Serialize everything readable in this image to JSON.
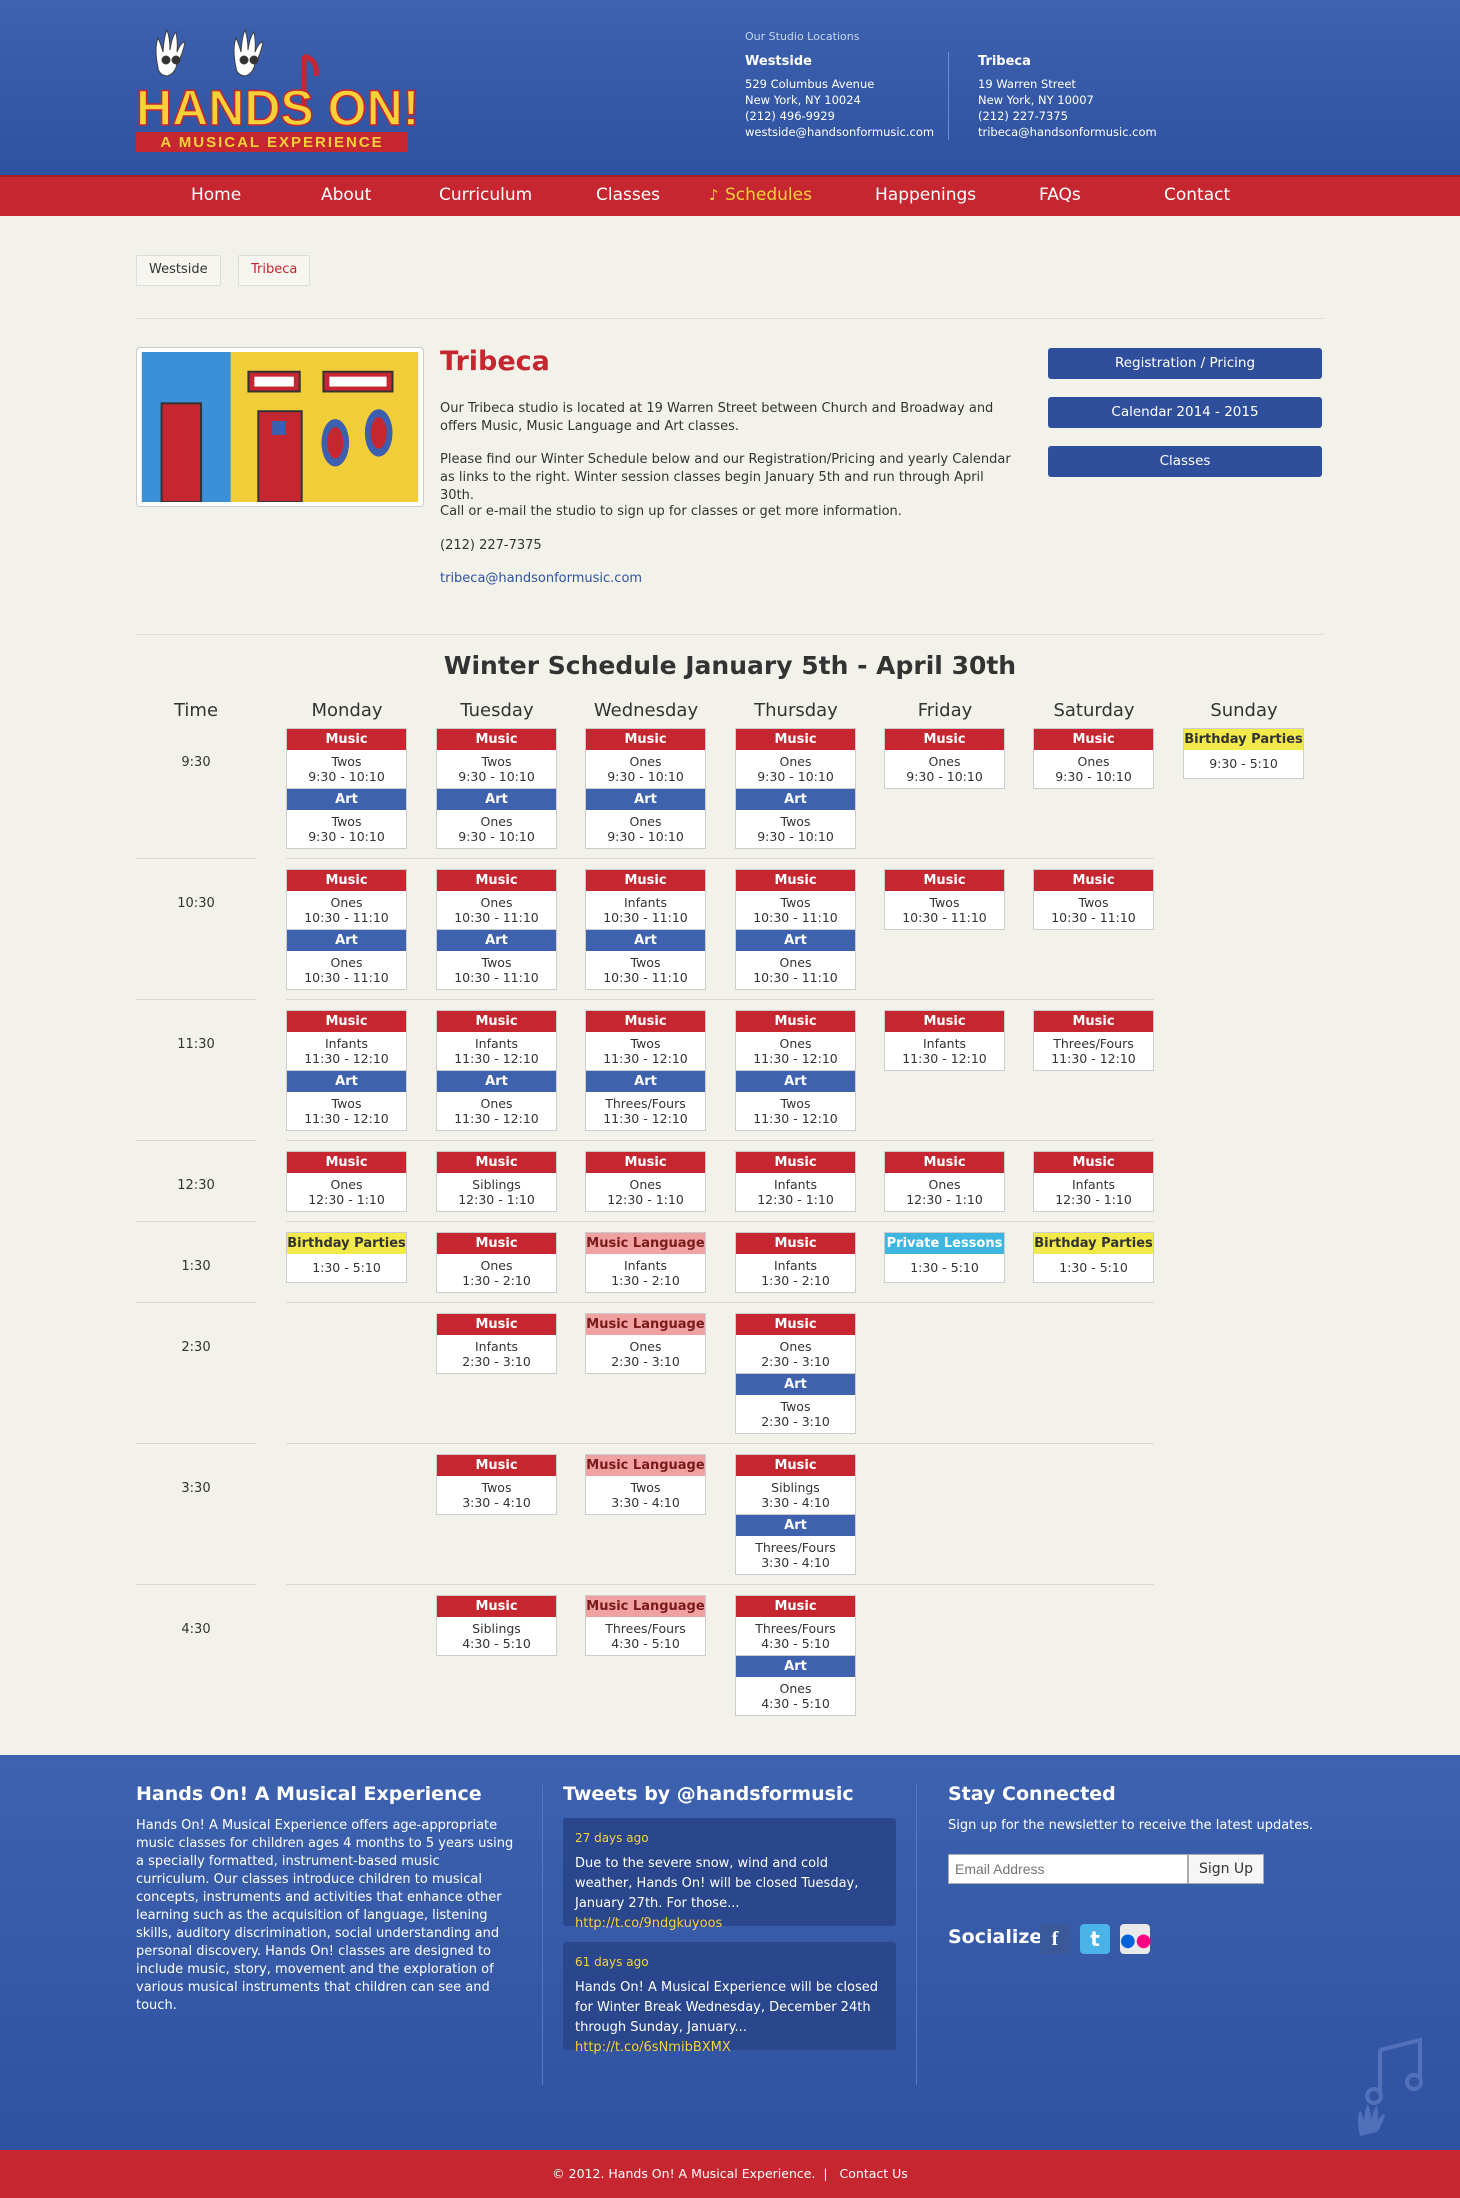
{
  "header": {
    "logo_text": "HANDS ON!",
    "logo_sub": "A MUSICAL EXPERIENCE",
    "locations_title": "Our Studio Locations",
    "locations": [
      {
        "name": "Westside",
        "address1": "529 Columbus Avenue",
        "address2": "New York, NY 10024",
        "phone": "(212) 496-9929",
        "email": "westside@handsonformusic.com"
      },
      {
        "name": "Tribeca",
        "address1": "19 Warren Street",
        "address2": "New York, NY 10007",
        "phone": "(212) 227-7375",
        "email": "tribeca@handsonformusic.com"
      }
    ]
  },
  "nav": {
    "items": [
      "Home",
      "About",
      "Curriculum",
      "Classes",
      "Schedules",
      "Happenings",
      "FAQs",
      "Contact"
    ],
    "active": "Schedules"
  },
  "tabs": [
    "Westside",
    "Tribeca"
  ],
  "intro": {
    "title": "Tribeca",
    "p1": "Our Tribeca studio is located at 19 Warren Street between Church and Broadway and offers Music, Music Language and Art classes.",
    "p2": "Please find our Winter Schedule below and our Registration/Pricing and yearly Calendar as links to the right. Winter session classes begin January 5th and run through April 30th.",
    "p3": "Call or e-mail the studio to sign up for classes or get more information.",
    "phone": "(212) 227-7375",
    "email": "tribeca@handsonformusic.com"
  },
  "side_buttons": [
    "Registration / Pricing",
    "Calendar 2014 - 2015",
    "Classes"
  ],
  "schedule": {
    "title": "Winter Schedule January 5th - April 30th",
    "time_header": "Time",
    "days": [
      "Monday",
      "Tuesday",
      "Wednesday",
      "Thursday",
      "Friday",
      "Saturday",
      "Sunday"
    ],
    "rows": [
      {
        "time": "9:30",
        "cells": [
          [
            {
              "type": "Music",
              "age": "Twos",
              "t": "9:30 - 10:10"
            },
            {
              "type": "Art",
              "age": "Twos",
              "t": "9:30 - 10:10"
            }
          ],
          [
            {
              "type": "Music",
              "age": "Twos",
              "t": "9:30 - 10:10"
            },
            {
              "type": "Art",
              "age": "Ones",
              "t": "9:30 - 10:10"
            }
          ],
          [
            {
              "type": "Music",
              "age": "Ones",
              "t": "9:30 - 10:10"
            },
            {
              "type": "Art",
              "age": "Ones",
              "t": "9:30 - 10:10"
            }
          ],
          [
            {
              "type": "Music",
              "age": "Ones",
              "t": "9:30 - 10:10"
            },
            {
              "type": "Art",
              "age": "Twos",
              "t": "9:30 - 10:10"
            }
          ],
          [
            {
              "type": "Music",
              "age": "Ones",
              "t": "9:30 - 10:10"
            }
          ],
          [
            {
              "type": "Music",
              "age": "Ones",
              "t": "9:30 - 10:10"
            }
          ],
          [
            {
              "type": "Birthday Parties",
              "age": "",
              "t": "9:30 - 5:10"
            }
          ]
        ]
      },
      {
        "time": "10:30",
        "cells": [
          [
            {
              "type": "Music",
              "age": "Ones",
              "t": "10:30 - 11:10"
            },
            {
              "type": "Art",
              "age": "Ones",
              "t": "10:30 - 11:10"
            }
          ],
          [
            {
              "type": "Music",
              "age": "Ones",
              "t": "10:30 - 11:10"
            },
            {
              "type": "Art",
              "age": "Twos",
              "t": "10:30 - 11:10"
            }
          ],
          [
            {
              "type": "Music",
              "age": "Infants",
              "t": "10:30 - 11:10"
            },
            {
              "type": "Art",
              "age": "Twos",
              "t": "10:30 - 11:10"
            }
          ],
          [
            {
              "type": "Music",
              "age": "Twos",
              "t": "10:30 - 11:10"
            },
            {
              "type": "Art",
              "age": "Ones",
              "t": "10:30 - 11:10"
            }
          ],
          [
            {
              "type": "Music",
              "age": "Twos",
              "t": "10:30 - 11:10"
            }
          ],
          [
            {
              "type": "Music",
              "age": "Twos",
              "t": "10:30 - 11:10"
            }
          ],
          []
        ]
      },
      {
        "time": "11:30",
        "cells": [
          [
            {
              "type": "Music",
              "age": "Infants",
              "t": "11:30 - 12:10"
            },
            {
              "type": "Art",
              "age": "Twos",
              "t": "11:30 - 12:10"
            }
          ],
          [
            {
              "type": "Music",
              "age": "Infants",
              "t": "11:30 - 12:10"
            },
            {
              "type": "Art",
              "age": "Ones",
              "t": "11:30 - 12:10"
            }
          ],
          [
            {
              "type": "Music",
              "age": "Twos",
              "t": "11:30 - 12:10"
            },
            {
              "type": "Art",
              "age": "Threes/Fours",
              "t": "11:30 - 12:10"
            }
          ],
          [
            {
              "type": "Music",
              "age": "Ones",
              "t": "11:30 - 12:10"
            },
            {
              "type": "Art",
              "age": "Twos",
              "t": "11:30 - 12:10"
            }
          ],
          [
            {
              "type": "Music",
              "age": "Infants",
              "t": "11:30 - 12:10"
            }
          ],
          [
            {
              "type": "Music",
              "age": "Threes/Fours",
              "t": "11:30 - 12:10"
            }
          ],
          []
        ]
      },
      {
        "time": "12:30",
        "cells": [
          [
            {
              "type": "Music",
              "age": "Ones",
              "t": "12:30 - 1:10"
            }
          ],
          [
            {
              "type": "Music",
              "age": "Siblings",
              "t": "12:30 - 1:10"
            }
          ],
          [
            {
              "type": "Music",
              "age": "Ones",
              "t": "12:30 - 1:10"
            }
          ],
          [
            {
              "type": "Music",
              "age": "Infants",
              "t": "12:30 - 1:10"
            }
          ],
          [
            {
              "type": "Music",
              "age": "Ones",
              "t": "12:30 - 1:10"
            }
          ],
          [
            {
              "type": "Music",
              "age": "Infants",
              "t": "12:30 - 1:10"
            }
          ],
          []
        ]
      },
      {
        "time": "1:30",
        "cells": [
          [
            {
              "type": "Birthday Parties",
              "age": "",
              "t": "1:30 - 5:10"
            }
          ],
          [
            {
              "type": "Music",
              "age": "Ones",
              "t": "1:30 - 2:10"
            }
          ],
          [
            {
              "type": "Music Language",
              "age": "Infants",
              "t": "1:30 - 2:10"
            }
          ],
          [
            {
              "type": "Music",
              "age": "Infants",
              "t": "1:30 - 2:10"
            }
          ],
          [
            {
              "type": "Private Lessons",
              "age": "",
              "t": "1:30 - 5:10"
            }
          ],
          [
            {
              "type": "Birthday Parties",
              "age": "",
              "t": "1:30 - 5:10"
            }
          ],
          []
        ]
      },
      {
        "time": "2:30",
        "cells": [
          [],
          [
            {
              "type": "Music",
              "age": "Infants",
              "t": "2:30 - 3:10"
            }
          ],
          [
            {
              "type": "Music Language",
              "age": "Ones",
              "t": "2:30 - 3:10"
            }
          ],
          [
            {
              "type": "Music",
              "age": "Ones",
              "t": "2:30 - 3:10"
            },
            {
              "type": "Art",
              "age": "Twos",
              "t": "2:30 - 3:10"
            }
          ],
          [],
          [],
          []
        ]
      },
      {
        "time": "3:30",
        "cells": [
          [],
          [
            {
              "type": "Music",
              "age": "Twos",
              "t": "3:30 - 4:10"
            }
          ],
          [
            {
              "type": "Music Language",
              "age": "Twos",
              "t": "3:30 - 4:10"
            }
          ],
          [
            {
              "type": "Music",
              "age": "Siblings",
              "t": "3:30 - 4:10"
            },
            {
              "type": "Art",
              "age": "Threes/Fours",
              "t": "3:30 - 4:10"
            }
          ],
          [],
          [],
          []
        ]
      },
      {
        "time": "4:30",
        "cells": [
          [],
          [
            {
              "type": "Music",
              "age": "Siblings",
              "t": "4:30 - 5:10"
            }
          ],
          [
            {
              "type": "Music Language",
              "age": "Threes/Fours",
              "t": "4:30 - 5:10"
            }
          ],
          [
            {
              "type": "Music",
              "age": "Threes/Fours",
              "t": "4:30 - 5:10"
            },
            {
              "type": "Art",
              "age": "Ones",
              "t": "4:30 - 5:10"
            }
          ],
          [],
          [],
          []
        ]
      }
    ]
  },
  "footer": {
    "about_title": "Hands On! A Musical Experience",
    "about_text": "Hands On! A Musical Experience offers age-appropriate music classes for children ages 4 months to 5 years using a specially formatted, instrument-based music curriculum. Our classes introduce children to musical concepts, instruments and activities that enhance other learning such as the acquisition of language, listening skills, auditory discrimination, social understanding and personal discovery. Hands On! classes are designed to include music, story, movement and the exploration of various musical instruments that children can see and touch.",
    "tweets_title": "Tweets by @handsformusic",
    "tweets": [
      {
        "date": "27 days ago",
        "text": "Due to the severe snow, wind and cold weather, Hands On! will be closed Tuesday, January 27th. For those...",
        "link": "http://t.co/9ndgkuyoos"
      },
      {
        "date": "61 days ago",
        "text": "Hands On! A Musical Experience will be closed for Winter Break Wednesday, December 24th through Sunday, January...",
        "link": "http://t.co/6sNmibBXMX"
      }
    ],
    "connect_title": "Stay Connected",
    "connect_text": "Sign up for the newsletter to receive the latest updates.",
    "email_placeholder": "Email Address",
    "signup_label": "Sign Up",
    "socialize_label": "Socialize:",
    "social_icons": [
      "facebook-icon",
      "twitter-icon",
      "flickr-icon"
    ],
    "copyright": "© 2012. Hands On! A Musical Experience.",
    "contact_link": "Contact Us"
  },
  "colors": {
    "blue": "#2f52a0",
    "red": "#c6262f",
    "yellow": "#f7d13a"
  }
}
